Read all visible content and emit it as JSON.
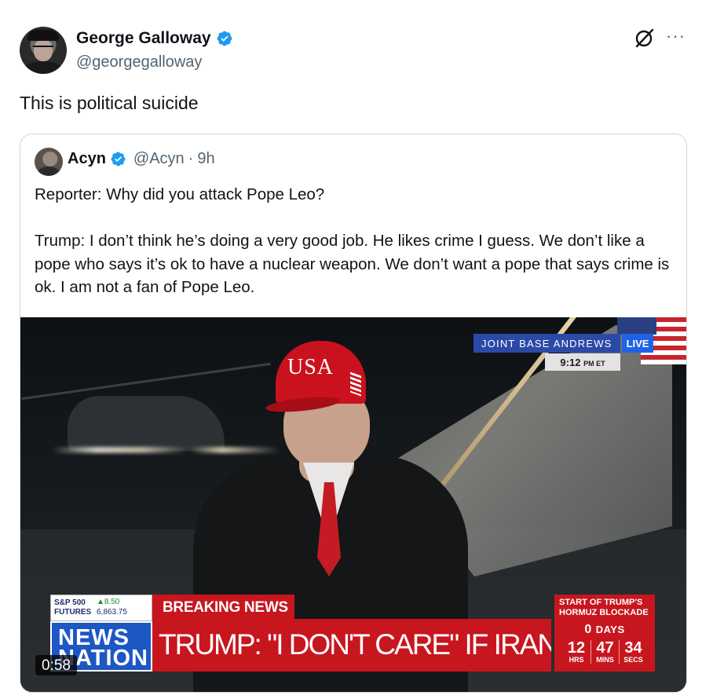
{
  "author": {
    "display_name": "George Galloway",
    "handle": "@georgegalloway",
    "verified": true,
    "avatar_icon": "avatar-photo"
  },
  "actions": {
    "grok_icon": "grok-icon",
    "more_label": "···"
  },
  "tweet": {
    "text": "This is political suicide"
  },
  "quoted": {
    "display_name": "Acyn",
    "handle": "@Acyn",
    "separator": "·",
    "time": "9h",
    "text_line1": "Reporter: Why did you attack Pope Leo?",
    "text_line2": "Trump: I don’t think he’s doing a very good job. He likes crime I guess. We don’t like a pope who says it’s ok to have a nuclear weapon. We don’t want a pope that says crime is ok. I am not a fan of Pope Leo."
  },
  "video": {
    "duration": "0:58",
    "cap_text": "USA",
    "location": "JOINT BASE ANDREWS",
    "live": "LIVE",
    "time_main": "9:12",
    "time_suffix": "PM ET",
    "market": {
      "label_line1": "S&P 500",
      "label_line2": "FUTURES",
      "change": "▲8.50",
      "price": "6,863.75"
    },
    "breaking": "BREAKING NEWS",
    "network_line1": "NEWS",
    "network_line2": "NATION",
    "headline": "TRUMP: \"I DON'T CARE\" IF IRAN NEGOTIATES",
    "countdown_title_line1": "START OF TRUMP'S",
    "countdown_title_line2": "HORMUZ BLOCKADE",
    "days_value": "0",
    "days_label": "DAYS",
    "hrs_value": "12",
    "hrs_label": "HRS",
    "mins_value": "47",
    "mins_label": "MINS",
    "secs_value": "34",
    "secs_label": "SECS"
  },
  "colors": {
    "verified_blue": "#1d9bf0",
    "text_primary": "#0f1419",
    "text_secondary": "#536471",
    "border": "#cfd9de",
    "news_red": "#c8161f",
    "news_blue": "#1d57c4"
  }
}
